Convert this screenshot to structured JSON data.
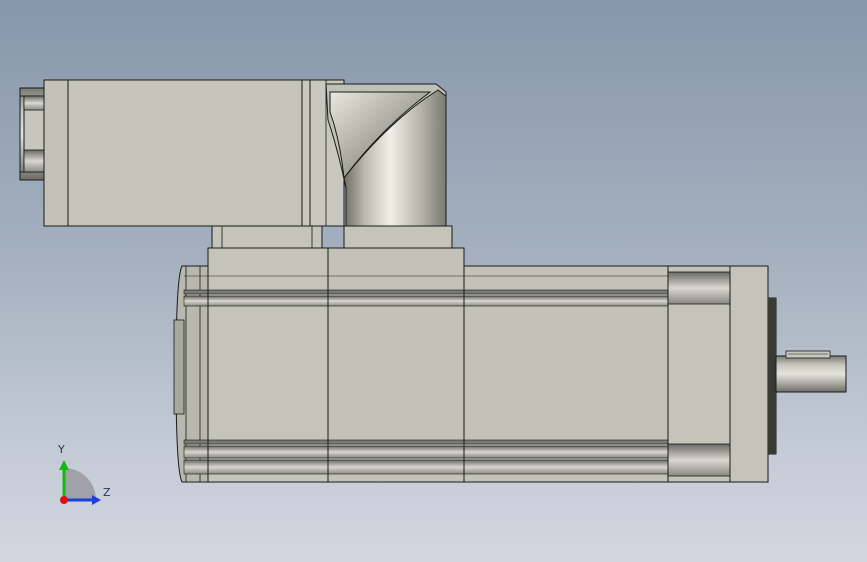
{
  "triad": {
    "y_label": "Y",
    "z_label": "Z",
    "colors": {
      "x_axis": "#e01010",
      "y_axis": "#14b814",
      "z_axis": "#1f3fd8"
    }
  },
  "model": {
    "colors": {
      "body": "#c0c0b6",
      "body_light": "#d6d6cd",
      "body_dark": "#8c8c84",
      "edge": "#1a1a1a",
      "background_top": "#8797ab",
      "background_bottom": "#d2d7df"
    }
  }
}
